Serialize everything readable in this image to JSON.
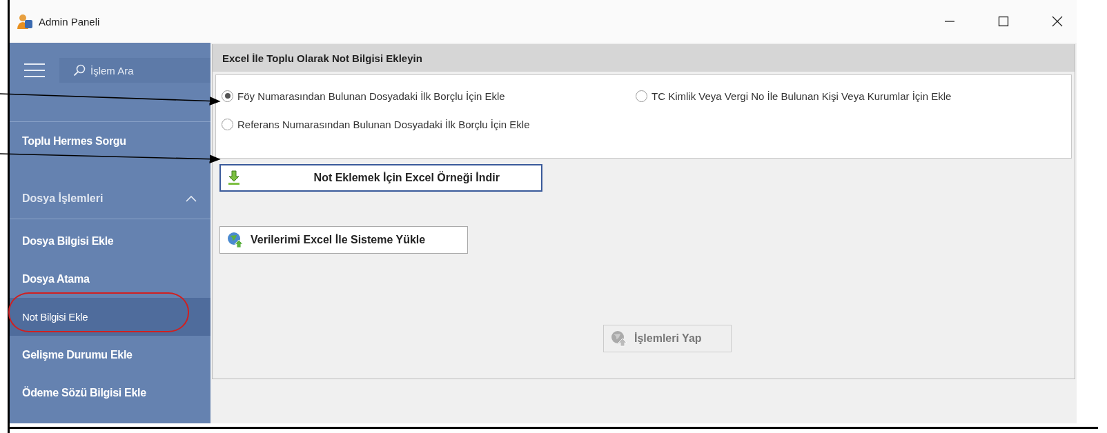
{
  "window": {
    "title": "Admin Paneli"
  },
  "sidebar": {
    "search": {
      "placeholder": "İşlem Ara"
    },
    "items": [
      {
        "kind": "item",
        "label": "Toplu Hermes Sorgu",
        "selected": false
      },
      {
        "kind": "group",
        "label": "Dosya İşlemleri",
        "expanded": true,
        "selected": false
      },
      {
        "kind": "item",
        "label": "Dosya Bilgisi Ekle",
        "selected": false
      },
      {
        "kind": "item",
        "label": "Dosya Atama",
        "selected": false
      },
      {
        "kind": "item",
        "label": "Not Bilgisi Ekle",
        "selected": true
      },
      {
        "kind": "item",
        "label": "Gelişme Durumu Ekle",
        "selected": false
      },
      {
        "kind": "item",
        "label": "Ödeme Sözü Bilgisi Ekle",
        "selected": false
      }
    ]
  },
  "panel": {
    "title": "Excel İle Toplu Olarak Not Bilgisi Ekleyin",
    "options": [
      {
        "label": "Föy Numarasından Bulunan Dosyadaki İlk Borçlu İçin Ekle",
        "selected": true
      },
      {
        "label": "TC Kimlik Veya Vergi No İle Bulunan Kişi Veya Kurumlar İçin Ekle",
        "selected": false
      },
      {
        "label": "Referans Numarasından Bulunan Dosyadaki İlk Borçlu İçin Ekle",
        "selected": false
      }
    ],
    "buttons": [
      {
        "kind": "download",
        "label": "Not Eklemek İçin Excel Örneği İndir",
        "disabled": false
      },
      {
        "kind": "upload",
        "label": "Verilerimi Excel İle Sisteme Yükle",
        "disabled": false
      },
      {
        "kind": "run",
        "label": "İşlemleri Yap",
        "disabled": true
      }
    ]
  }
}
